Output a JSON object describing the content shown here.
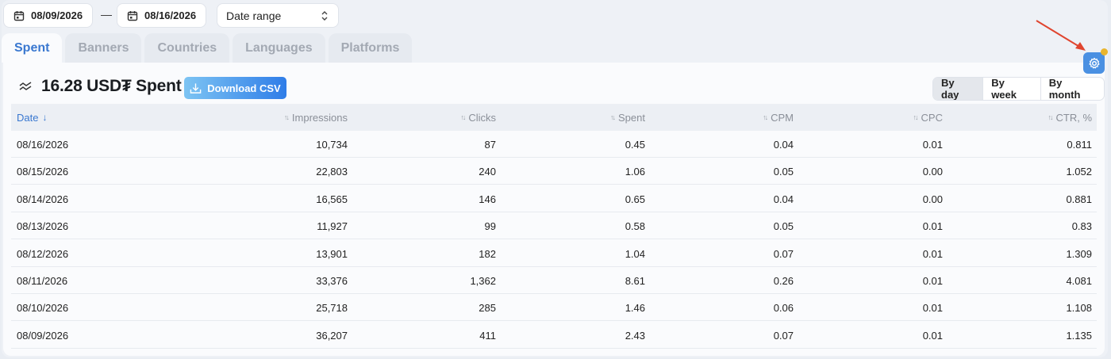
{
  "dates": {
    "from": "08/09/2026",
    "to": "08/16/2026",
    "separator": "—"
  },
  "range_select": {
    "value": "Date range"
  },
  "tabs": [
    "Spent",
    "Banners",
    "Countries",
    "Languages",
    "Platforms"
  ],
  "summary": {
    "total": "16.28 USD₮ Spent"
  },
  "csv_button": "Download CSV",
  "period": [
    "By day",
    "By week",
    "By month"
  ],
  "colors": {
    "accent": "#3a78d0",
    "settings": "#4a90e2",
    "dot": "#e9b52e",
    "arrow": "#e0452f"
  },
  "table": {
    "headers": [
      "Date",
      "Impressions",
      "Clicks",
      "Spent",
      "CPM",
      "CPC",
      "CTR, %"
    ],
    "rows": [
      [
        "08/16/2026",
        "10,734",
        "87",
        "0.45",
        "0.04",
        "0.01",
        "0.811"
      ],
      [
        "08/15/2026",
        "22,803",
        "240",
        "1.06",
        "0.05",
        "0.00",
        "1.052"
      ],
      [
        "08/14/2026",
        "16,565",
        "146",
        "0.65",
        "0.04",
        "0.00",
        "0.881"
      ],
      [
        "08/13/2026",
        "11,927",
        "99",
        "0.58",
        "0.05",
        "0.01",
        "0.83"
      ],
      [
        "08/12/2026",
        "13,901",
        "182",
        "1.04",
        "0.07",
        "0.01",
        "1.309"
      ],
      [
        "08/11/2026",
        "33,376",
        "1,362",
        "8.61",
        "0.26",
        "0.01",
        "4.081"
      ],
      [
        "08/10/2026",
        "25,718",
        "285",
        "1.46",
        "0.06",
        "0.01",
        "1.108"
      ],
      [
        "08/09/2026",
        "36,207",
        "411",
        "2.43",
        "0.07",
        "0.01",
        "1.135"
      ]
    ]
  }
}
